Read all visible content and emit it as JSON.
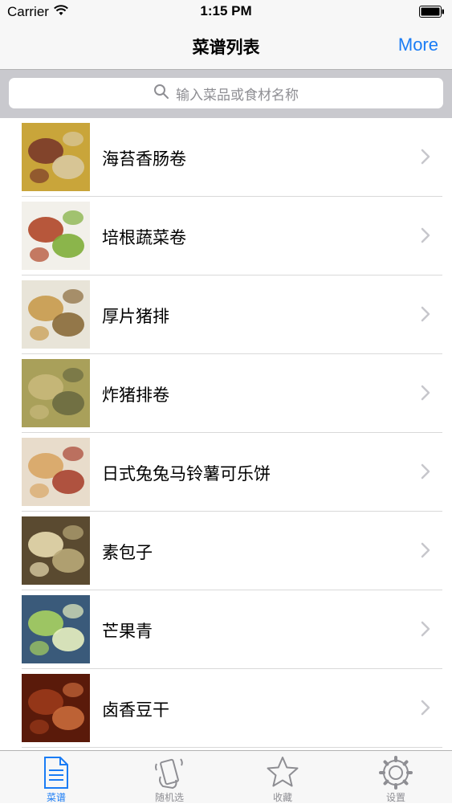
{
  "status_bar": {
    "carrier": "Carrier",
    "time": "1:15 PM"
  },
  "nav": {
    "title": "菜谱列表",
    "more_label": "More"
  },
  "search": {
    "placeholder": "输入菜品或食材名称"
  },
  "list": {
    "items": [
      {
        "title": "海苔香肠卷",
        "thumb_colors": [
          "#c9a53a",
          "#7a3a2a",
          "#d8c9a0"
        ]
      },
      {
        "title": "培根蔬菜卷",
        "thumb_colors": [
          "#f2f0ea",
          "#b04628",
          "#7fae3a"
        ]
      },
      {
        "title": "厚片猪排",
        "thumb_colors": [
          "#e8e4d8",
          "#c89a4c",
          "#8a6a3a"
        ]
      },
      {
        "title": "炸猪排卷",
        "thumb_colors": [
          "#a9a05a",
          "#c8b87a",
          "#6a6a40"
        ]
      },
      {
        "title": "日式兔兔马铃薯可乐饼",
        "thumb_colors": [
          "#e8dccb",
          "#d8a564",
          "#a84230"
        ]
      },
      {
        "title": "素包子",
        "thumb_colors": [
          "#5a4a30",
          "#e8dcb0",
          "#b8a878"
        ]
      },
      {
        "title": "芒果青",
        "thumb_colors": [
          "#3a5a7a",
          "#a8d060",
          "#e8f0c0"
        ]
      },
      {
        "title": "卤香豆干",
        "thumb_colors": [
          "#5a1a0a",
          "#9a3a1a",
          "#c86a3a"
        ]
      }
    ]
  },
  "tabs": [
    {
      "label": "菜谱",
      "icon": "document-icon",
      "active": true
    },
    {
      "label": "随机选",
      "icon": "shake-phone-icon",
      "active": false
    },
    {
      "label": "收藏",
      "icon": "star-icon",
      "active": false
    },
    {
      "label": "设置",
      "icon": "gear-icon",
      "active": false
    }
  ],
  "colors": {
    "accent": "#1a7cf5",
    "inactive": "#8e8e93"
  }
}
